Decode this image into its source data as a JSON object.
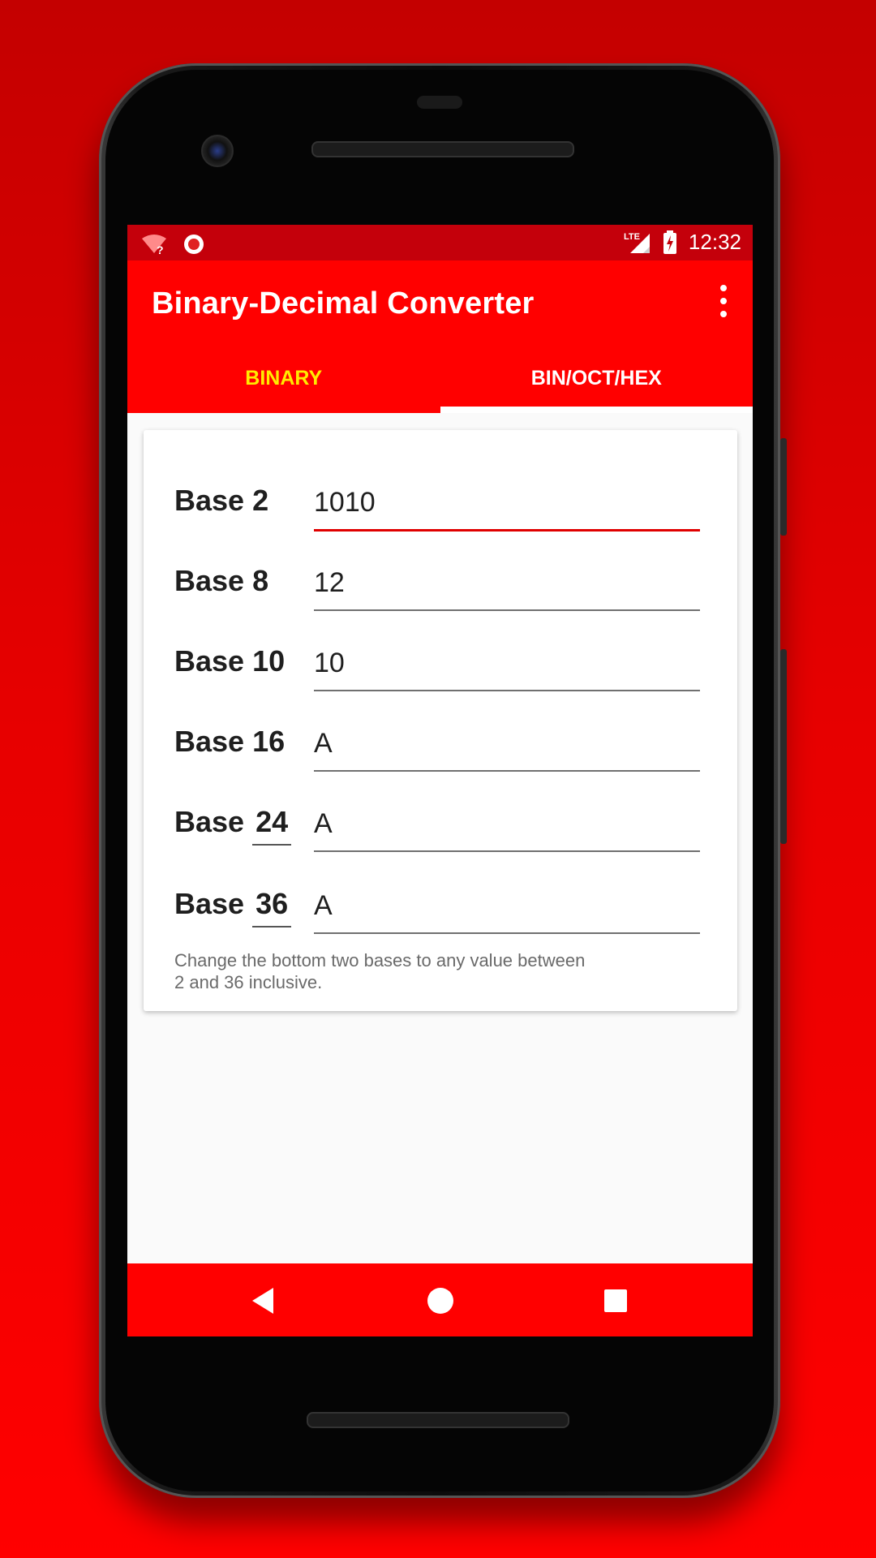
{
  "status": {
    "time": "12:32",
    "network": "LTE"
  },
  "appbar": {
    "title": "Binary-Decimal Converter"
  },
  "tabs": [
    {
      "label": "BINARY",
      "active": false
    },
    {
      "label": "BIN/OCT/HEX",
      "active": true
    }
  ],
  "converter": {
    "rows": [
      {
        "word": "Base",
        "base": "2",
        "value": "1010",
        "base_editable": false
      },
      {
        "word": "Base",
        "base": "8",
        "value": "12",
        "base_editable": false
      },
      {
        "word": "Base",
        "base": "10",
        "value": "10",
        "base_editable": false
      },
      {
        "word": "Base",
        "base": "16",
        "value": "A",
        "base_editable": false
      },
      {
        "word": "Base",
        "base": "24",
        "value": "A",
        "base_editable": true
      },
      {
        "word": "Base",
        "base": "36",
        "value": "A",
        "base_editable": true
      }
    ],
    "help_line1": "Change the bottom two bases to any value between",
    "help_line2": "2 and 36 inclusive."
  },
  "colors": {
    "primary": "#ff0000",
    "status_bar": "#c4000b",
    "tab_inactive": "#ffeb00",
    "focus_underline": "#e00000"
  }
}
